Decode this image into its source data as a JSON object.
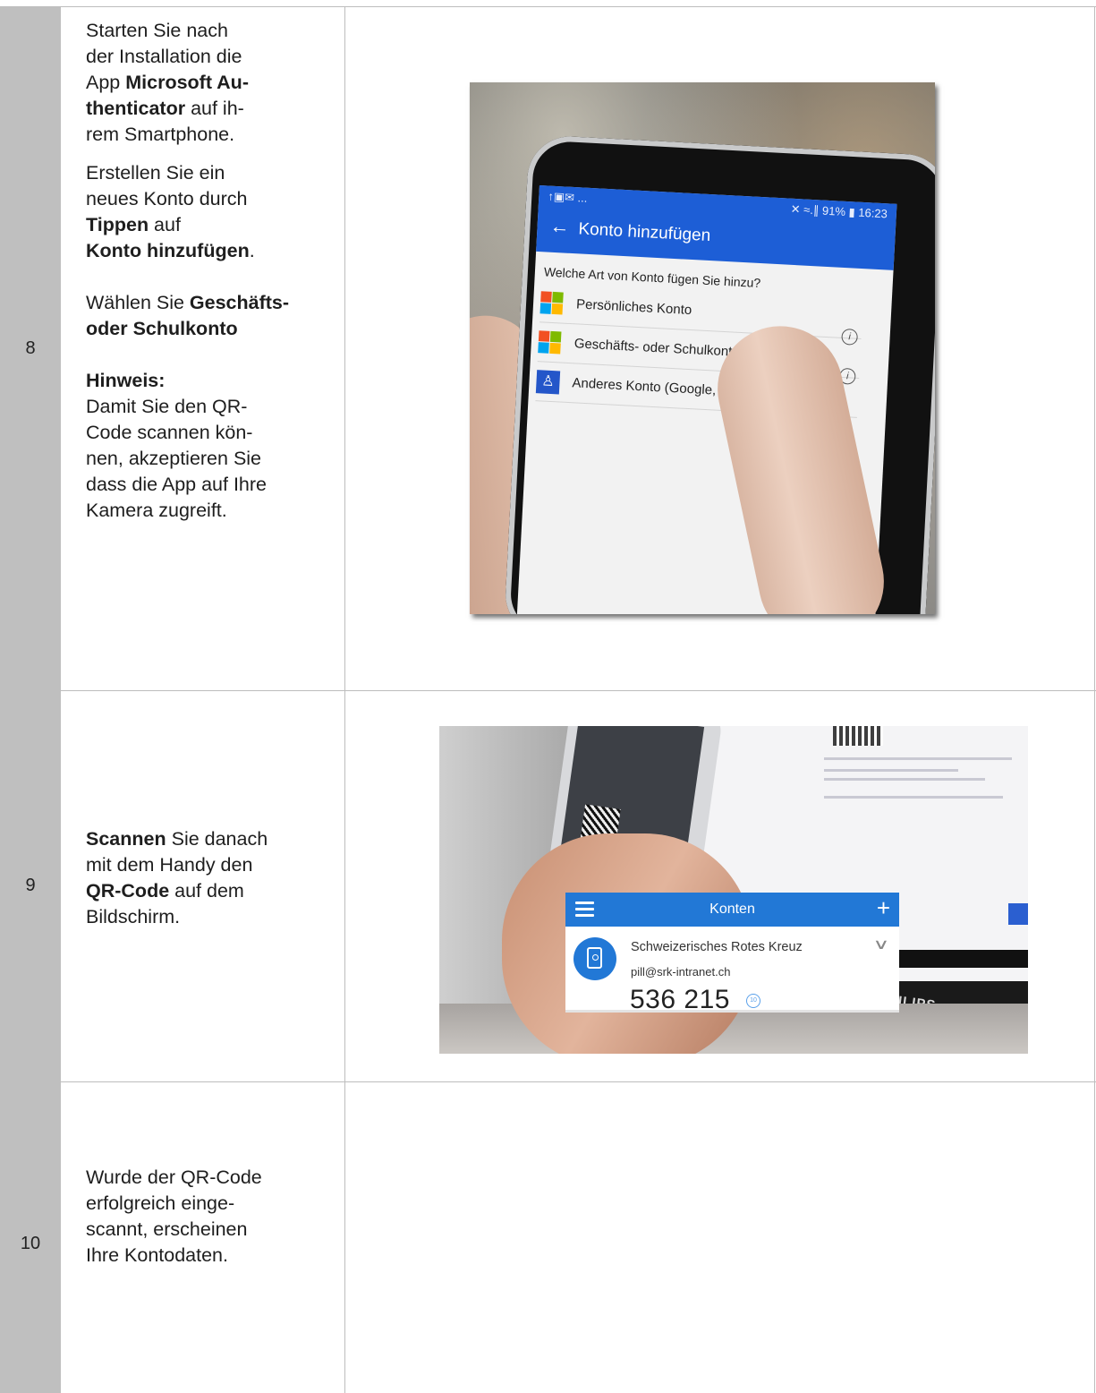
{
  "steps": [
    {
      "number": "8",
      "paragraphs": {
        "p1": {
          "t1": "Starten Sie nach",
          "t2": "der Installation die",
          "t3": "App ",
          "b1": "Microsoft Au-",
          "b2": "thenticator",
          "t4": " auf ih-",
          "t5": "rem Smartphone."
        },
        "p2": {
          "t1": "Erstellen Sie ein",
          "t2": "neues Konto durch",
          "b1": "Tippen",
          "t3": " auf",
          "b2": "Konto hinzufügen",
          "t4": "."
        },
        "p3": {
          "t1": "Wählen Sie ",
          "b1": "Geschäfts-",
          "b2": "oder Schulkonto"
        },
        "note": {
          "label": "Hinweis:",
          "t1": "Damit Sie den QR-",
          "t2": "Code scannen kön-",
          "t3": "nen, akzeptieren Sie",
          "t4": "dass die App auf Ihre",
          "t5": "Kamera zugreift."
        }
      },
      "screenshot": {
        "status_left": "↑▣✉ ...",
        "status_right": "✕ ≈.∥ 91% ▮ 16:23",
        "back": "←",
        "title": "Konto hinzufügen",
        "question": "Welche Art von Konto fügen Sie hinzu?",
        "options": [
          "Persönliches Konto",
          "Geschäfts- oder Schulkonto",
          "Anderes Konto (Google, Fa"
        ],
        "info_glyph": "i",
        "person_glyph": "♙"
      }
    },
    {
      "number": "9",
      "text": {
        "b1": "Scannen",
        "t1": " Sie danach",
        "t2": "mit dem Handy den",
        "b2": "QR-Code",
        "t3": " auf dem",
        "t4": "Bildschirm."
      },
      "screenshot": {
        "brand": "PHILIPS"
      }
    },
    {
      "number": "10",
      "text": {
        "t1": "Wurde der QR-Code",
        "t2": "erfolgreich einge-",
        "t3": "scannt, erscheinen",
        "t4": "Ihre Kontodaten."
      },
      "screenshot": {
        "title": "Konten",
        "plus": "+",
        "organization": "Schweizerisches Rotes Kreuz",
        "email": "pill@srk-intranet.ch",
        "code": "536 215",
        "timer": "10",
        "chevron": "∨"
      }
    }
  ],
  "colors": {
    "number_column": "#bfbfbf",
    "app_blue": "#1d5ed6",
    "konten_blue": "#2278d6",
    "ms_logo": [
      "#f25022",
      "#7fba00",
      "#00a4ef",
      "#ffb900"
    ]
  }
}
